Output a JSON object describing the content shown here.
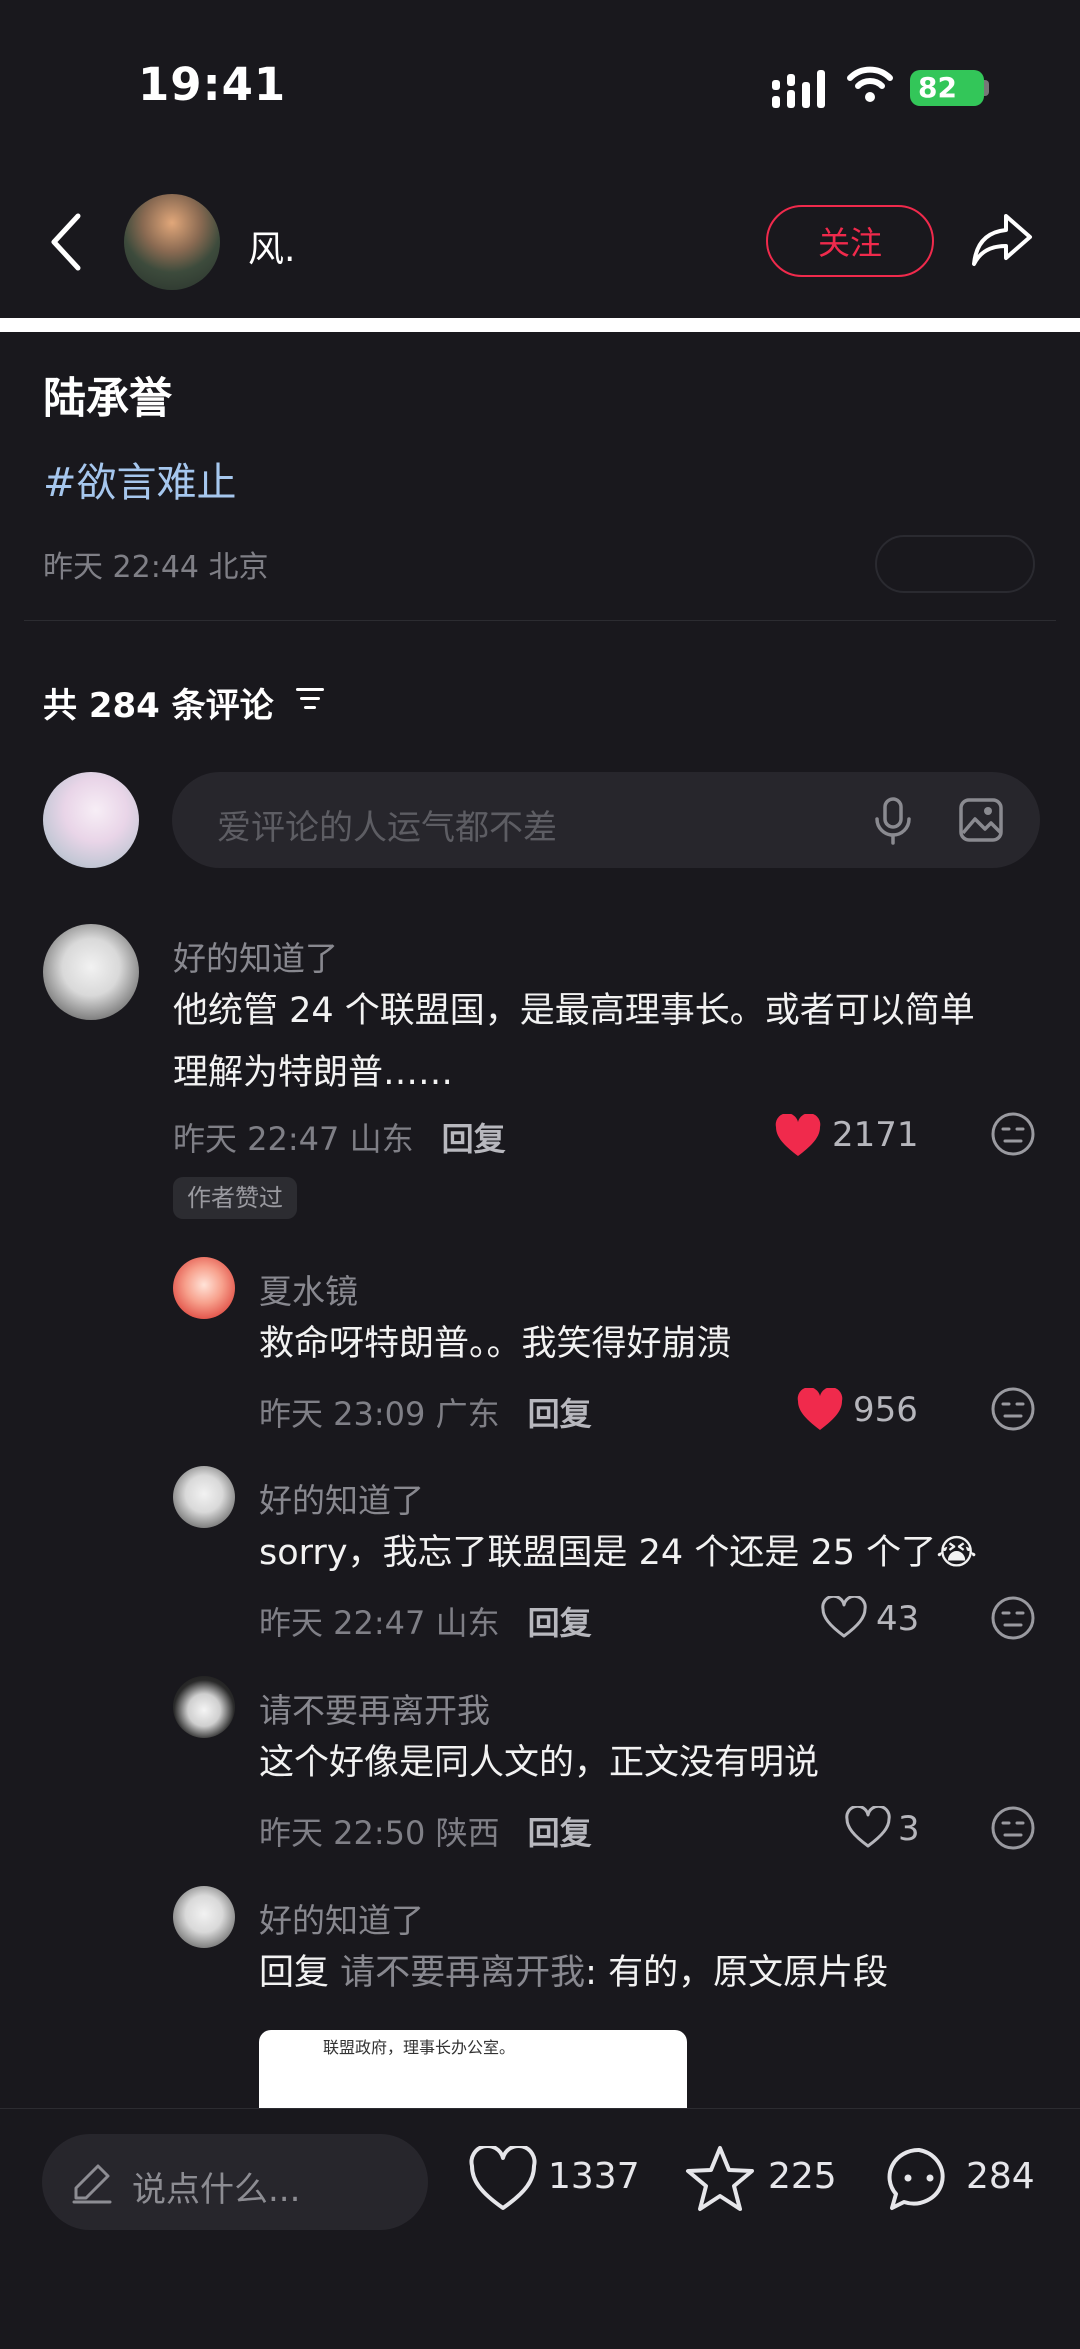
{
  "status_bar": {
    "time": "19:41",
    "battery": "82"
  },
  "header": {
    "author_name": "风.",
    "follow_label": "关注"
  },
  "post": {
    "title": "陆承誉",
    "hashtag": "#欲言难止",
    "meta": "昨天 22:44 北京"
  },
  "comments_section": {
    "count_label": "共 284 条评论",
    "input_placeholder": "爱评论的人运气都不差"
  },
  "comments": [
    {
      "name": "好的知道了",
      "text_line1": "他统管 24 个联盟国，是最高理事长。或者可以简单",
      "text_line2": "理解为特朗普……",
      "meta": "昨天 22:47 山东",
      "reply_label": "回复",
      "likes": "2171",
      "badge": "作者赞过",
      "liked": true
    },
    {
      "name": "夏水镜",
      "text": "救命呀特朗普。。我笑得好崩溃",
      "meta": "昨天 23:09 广东",
      "reply_label": "回复",
      "likes": "956",
      "liked": true
    },
    {
      "name": "好的知道了",
      "text": "sorry，我忘了联盟国是 24 个还是 25 个了",
      "emoji": "😭",
      "meta": "昨天 22:47 山东",
      "reply_label": "回复",
      "likes": "43",
      "liked": false
    },
    {
      "name": "请不要再离开我",
      "text": "这个好像是同人文的，正文没有明说",
      "meta": "昨天 22:50 陕西",
      "reply_label": "回复",
      "likes": "3",
      "liked": false
    },
    {
      "name": "好的知道了",
      "reply_prefix": "回复",
      "reply_to": "请不要再离开我",
      "text": ": 有的，原文原片段",
      "image_caption": "联盟政府，理事长办公室。"
    }
  ],
  "bottom_bar": {
    "say_placeholder": "说点什么...",
    "likes": "1337",
    "favorites": "225",
    "comments": "284"
  },
  "colors": {
    "accent": "#f02a4c",
    "hashtag": "#a6c7ee",
    "background": "#19181d"
  }
}
